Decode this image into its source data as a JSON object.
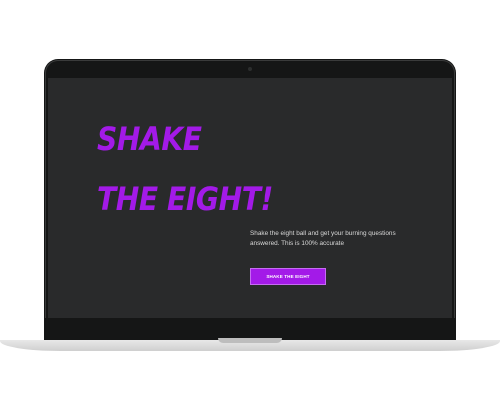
{
  "hero": {
    "title_line1": "SHAKE",
    "title_line2": "THE EIGHT!",
    "description": "Shake the eight ball and get your burning questions answered. This is 100% accurate",
    "cta_label": "SHAKE THE EIGHT"
  },
  "colors": {
    "accent": "#a31ae8",
    "screen_background": "#292a2b",
    "bezel": "#151616",
    "text": "#d9d9d9"
  }
}
